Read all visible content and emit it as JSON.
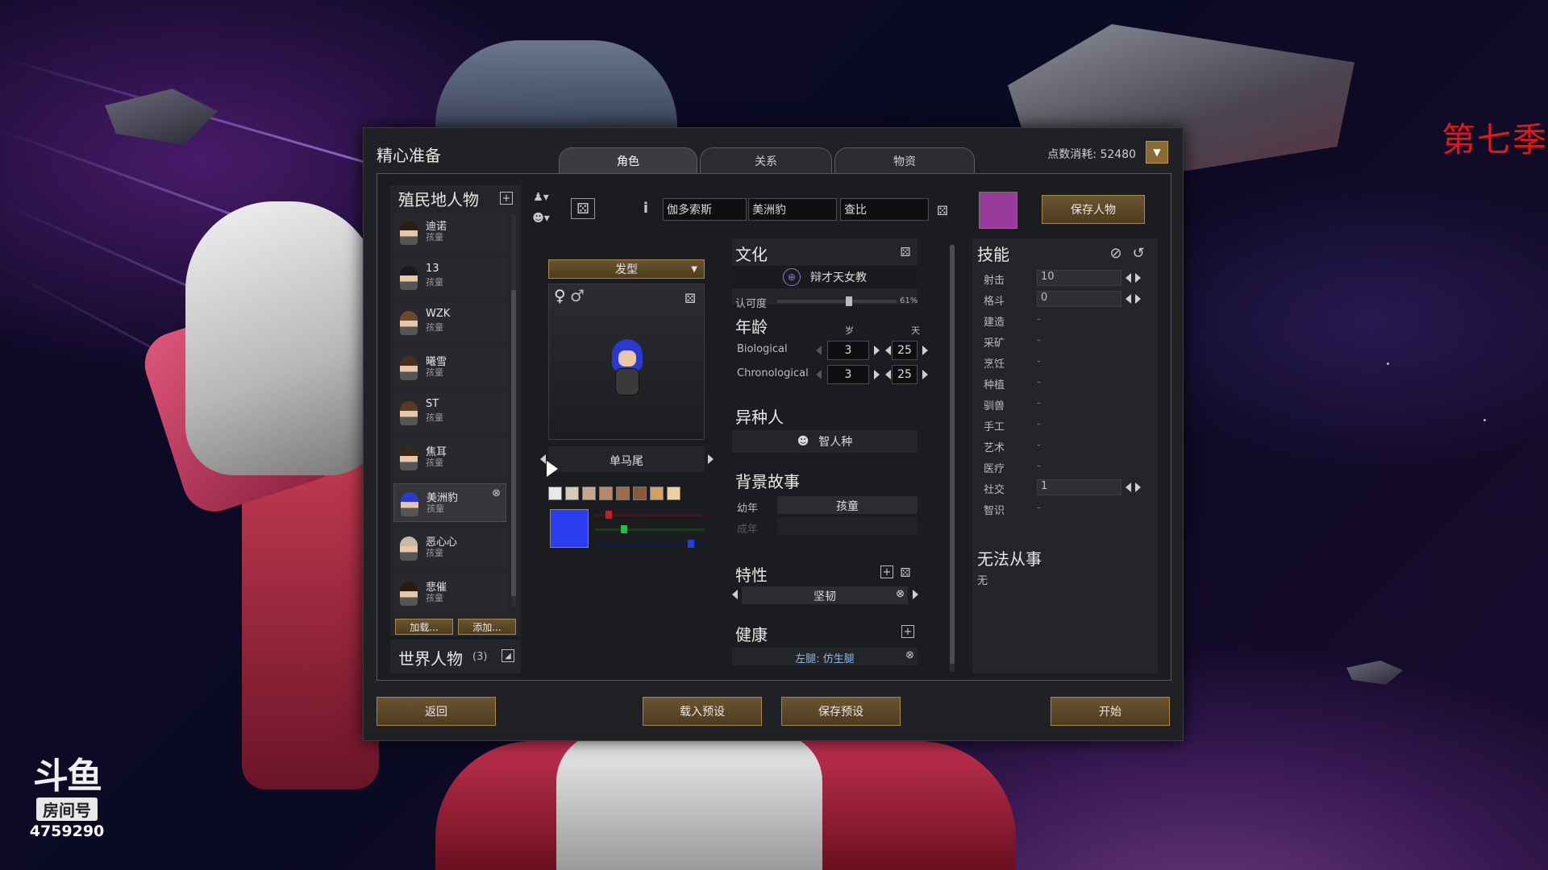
{
  "overlay": {
    "season_text": "第七季",
    "logo_mark": "斗鱼",
    "logo_room": "房间号",
    "room_number": "4759290"
  },
  "window": {
    "title": "精心准备",
    "points_label": "点数消耗: 52480",
    "tabs": [
      {
        "label": "角色",
        "active": true
      },
      {
        "label": "关系",
        "active": false
      },
      {
        "label": "物资",
        "active": false
      }
    ]
  },
  "colonists": {
    "title": "殖民地人物",
    "items": [
      {
        "name": "迪诺",
        "sub": "孩童",
        "hair": "#2a1e14"
      },
      {
        "name": "13",
        "sub": "孩童",
        "hair": "#1a1a1a"
      },
      {
        "name": "WZK",
        "sub": "孩童",
        "hair": "#6a4a2a"
      },
      {
        "name": "曦雪",
        "sub": "孩童",
        "hair": "#4a2e1e"
      },
      {
        "name": "ST",
        "sub": "孩童",
        "hair": "#5a3a22"
      },
      {
        "name": "焦耳",
        "sub": "孩童",
        "hair": "#3a2616"
      },
      {
        "name": "美洲豹",
        "sub": "孩童",
        "hair": "#2a3ad0"
      },
      {
        "name": "恶心心",
        "sub": "孩童",
        "hair": "#c8b8a8"
      },
      {
        "name": "悲催",
        "sub": "孩童",
        "hair": "#2a1a10"
      }
    ],
    "load_button": "加载...",
    "add_button": "添加...",
    "world_title": "世界人物",
    "world_count": "(3)"
  },
  "name_fields": {
    "first": "伽多索斯",
    "nick": "美洲豹",
    "last": "查比"
  },
  "favorite_color": "#9a3a9a",
  "save_character": "保存人物",
  "appearance": {
    "hair_dropdown": "发型",
    "gender_female": "♀",
    "gender_male": "♂",
    "hairstyle_name": "单马尾",
    "skin_swatches": [
      "#e8e8e8",
      "#d8c8b8",
      "#c8a888",
      "#b88868",
      "#a06a48",
      "#8a5a38",
      "#d8a060",
      "#f0d0a0"
    ],
    "hair_color": "#2a3ef0",
    "slider_levels": {
      "red": 0.1,
      "green": 0.25,
      "blue": 0.9
    }
  },
  "culture": {
    "title": "文化",
    "ideology": "辩才天女教",
    "certainty_label": "认可度",
    "certainty_value": "61%",
    "certainty_level": 0.61
  },
  "age": {
    "title": "年龄",
    "years_label": "岁",
    "days_label": "天",
    "rows": [
      {
        "label": "Biological",
        "years": "3",
        "days": "25"
      },
      {
        "label": "Chronological",
        "years": "3",
        "days": "25"
      }
    ]
  },
  "xenotype": {
    "title": "异种人",
    "value": "智人种"
  },
  "backstory": {
    "title": "背景故事",
    "childhood_label": "幼年",
    "childhood_value": "孩童",
    "adulthood_label": "成年",
    "adulthood_value": ""
  },
  "traits": {
    "title": "特性",
    "items": [
      "坚韧"
    ]
  },
  "health": {
    "title": "健康",
    "entry_part": "左腿:",
    "entry_value": "仿生腿"
  },
  "skills": {
    "title": "技能",
    "rows": [
      {
        "name": "射击",
        "value": "10",
        "has_bar": true
      },
      {
        "name": "格斗",
        "value": "0",
        "has_bar": true
      },
      {
        "name": "建造",
        "value": "-",
        "has_bar": false
      },
      {
        "name": "采矿",
        "value": "-",
        "has_bar": false
      },
      {
        "name": "烹饪",
        "value": "-",
        "has_bar": false
      },
      {
        "name": "种植",
        "value": "-",
        "has_bar": false
      },
      {
        "name": "驯兽",
        "value": "-",
        "has_bar": false
      },
      {
        "name": "手工",
        "value": "-",
        "has_bar": false
      },
      {
        "name": "艺术",
        "value": "-",
        "has_bar": false
      },
      {
        "name": "医疗",
        "value": "-",
        "has_bar": false
      },
      {
        "name": "社交",
        "value": "1",
        "has_bar": true
      },
      {
        "name": "智识",
        "value": "-",
        "has_bar": false
      }
    ]
  },
  "incapable": {
    "title": "无法从事",
    "value": "无"
  },
  "footer": {
    "back": "返回",
    "load_preset": "载入预设",
    "save_preset": "保存预设",
    "start": "开始"
  }
}
